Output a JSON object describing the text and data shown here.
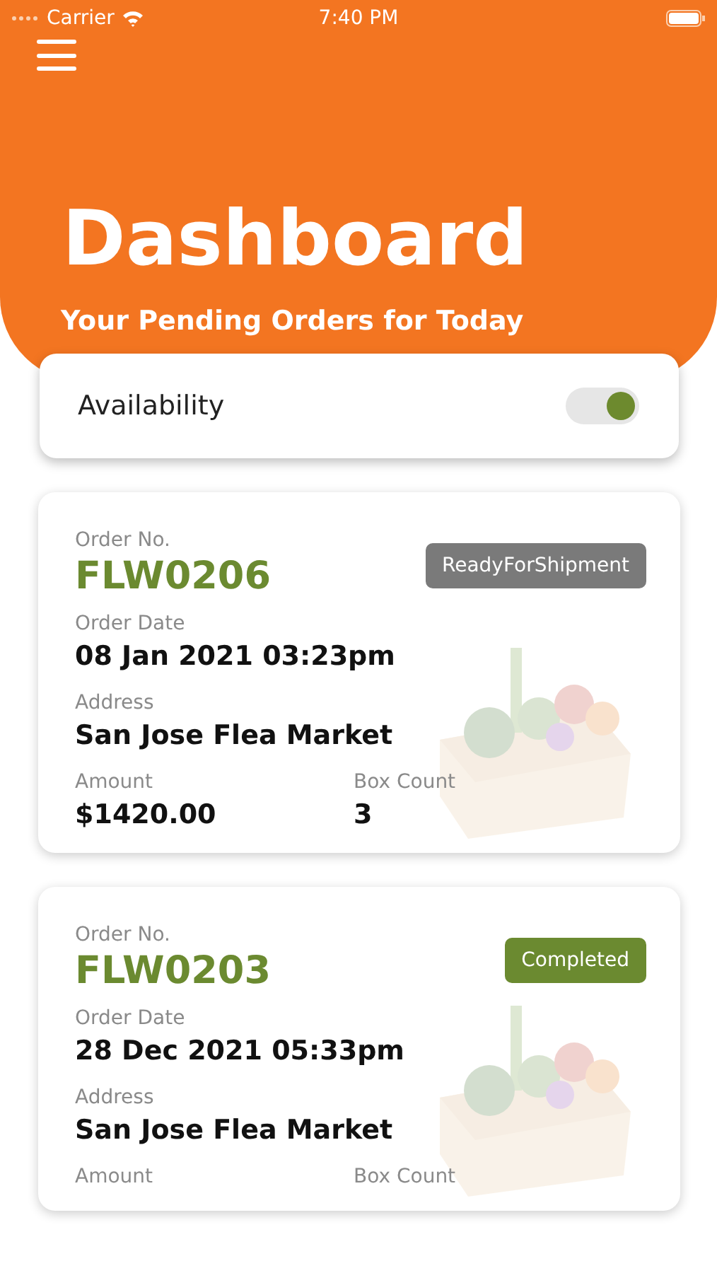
{
  "status_bar": {
    "carrier": "Carrier",
    "time": "7:40 PM"
  },
  "header": {
    "title": "Dashboard",
    "subtitle": "Your Pending Orders for Today"
  },
  "availability": {
    "label": "Availability",
    "on": true
  },
  "orders": [
    {
      "order_label": "Order No.",
      "order_no": "FLW0206",
      "status": "ReadyForShipment",
      "kind": "ready",
      "date_label": "Order Date",
      "date": "08 Jan 2021 03:23pm",
      "address_label": "Address",
      "address": "San Jose Flea Market",
      "amount_label": "Amount",
      "amount": "$1420.00",
      "box_label": "Box Count",
      "box_count": "3"
    },
    {
      "order_label": "Order No.",
      "order_no": "FLW0203",
      "status": "Completed",
      "kind": "completed",
      "date_label": "Order Date",
      "date": "28 Dec 2021 05:33pm",
      "address_label": "Address",
      "address": "San Jose Flea Market",
      "amount_label": "Amount",
      "box_label": "Box Count"
    }
  ]
}
